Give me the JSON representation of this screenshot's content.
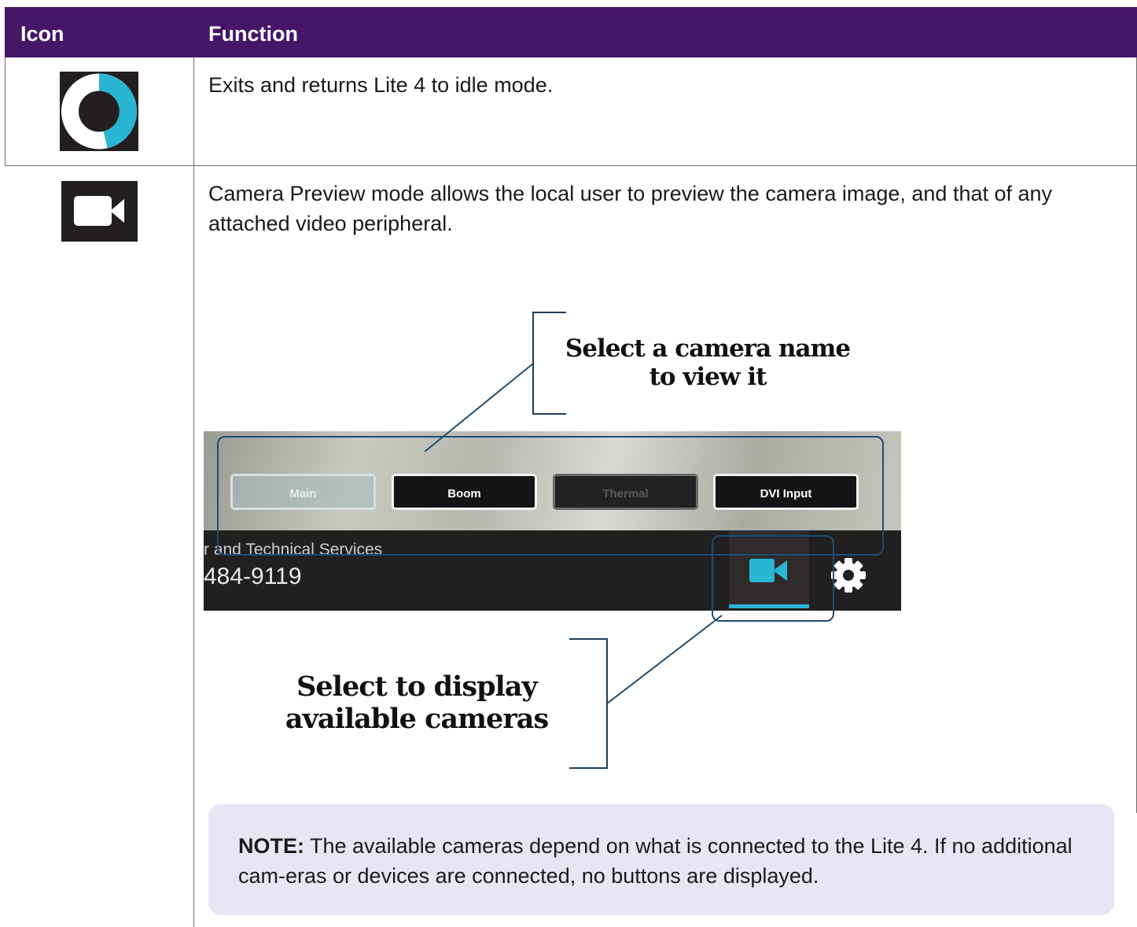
{
  "table": {
    "headers": {
      "icon": "Icon",
      "function": "Function"
    },
    "rows": [
      {
        "icon": "exit-ring-icon",
        "function": "Exits and returns Lite 4 to idle mode."
      },
      {
        "icon": "video-camera-icon",
        "function": "Camera Preview mode allows the local user to preview the camera image, and that of any attached video peripheral."
      }
    ]
  },
  "screenshot": {
    "camera_buttons": [
      "Main",
      "Boom",
      "Thermal",
      "DVI Input"
    ],
    "line1": "r and Technical Services",
    "line2": "484-9119"
  },
  "callouts": {
    "top": "Select a camera name to view it",
    "bottom": "Select to display available cameras"
  },
  "note": {
    "label": "NOTE:",
    "text": " The available cameras depend on what is connected to the Lite 4. If no additional cam-eras or devices are connected, no buttons are displayed."
  },
  "colors": {
    "header_bg": "#451568",
    "accent_cyan": "#29b6d4",
    "note_bg": "#e8e5f5"
  }
}
